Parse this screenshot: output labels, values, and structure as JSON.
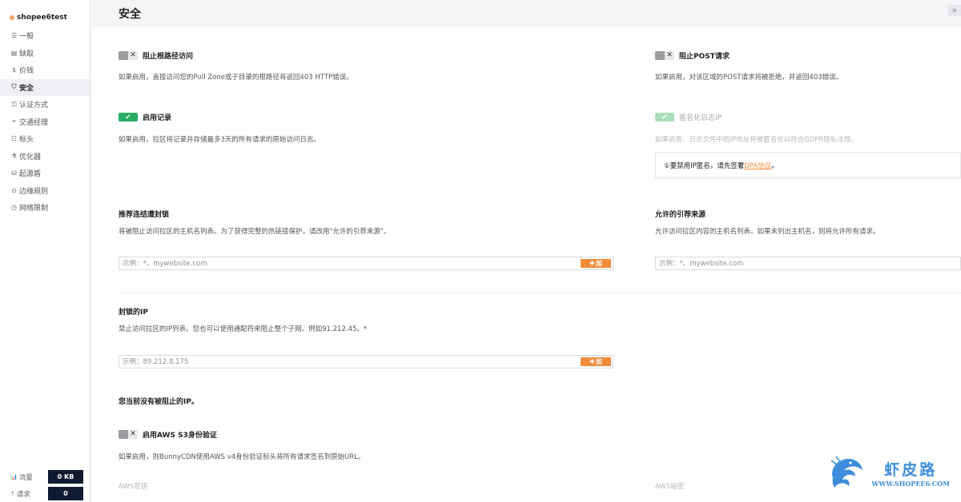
{
  "app": {
    "name": "shopee6test"
  },
  "sidebar": {
    "items": [
      {
        "icon": "☰",
        "label": "一般"
      },
      {
        "icon": "▤",
        "label": "缺取"
      },
      {
        "icon": "$",
        "label": "价钱"
      },
      {
        "icon": "⛉",
        "label": "安全"
      },
      {
        "icon": "⚿",
        "label": "认证方式"
      },
      {
        "icon": "⌖",
        "label": "交通经理"
      },
      {
        "icon": "☷",
        "label": "标头"
      },
      {
        "icon": "⚗",
        "label": "优化器"
      },
      {
        "icon": "⛁",
        "label": "起源盾"
      },
      {
        "icon": "⊙",
        "label": "边缘规则"
      },
      {
        "icon": "◷",
        "label": "网络限制"
      }
    ],
    "active_index": 3,
    "stats": [
      {
        "icon": "📊",
        "label": "流量",
        "value": "0 KB"
      },
      {
        "icon": "⇡",
        "label": "请求",
        "value": "0"
      }
    ]
  },
  "header": {
    "title": "安全",
    "menu_icon": "≡"
  },
  "settings": {
    "block_root": {
      "title": "阻止根路径访问",
      "desc": "如果启用，直接访问您的Pull Zone或子目录的根路径将返回403 HTTP错误。",
      "state": "off"
    },
    "block_post": {
      "title": "阻止POST请求",
      "desc": "如果启用，对该区域的POST请求将被拒绝，并返回403错误。",
      "state": "off"
    },
    "enable_logging": {
      "title": "启用记录",
      "desc": "如果启用，拉区将记录并存储最多3天的所有请求的原始访问日志。",
      "state": "on"
    },
    "anonymize_ip": {
      "title": "匿名化日志IP",
      "desc": "如果启用，日志文件中的IP地址将被匿名化以符合GDPR隐私法规。",
      "state": "on-disabled"
    },
    "dpa_notice": {
      "prefix": "①要禁用IP匿名，请先签署",
      "link": "DPA协议",
      "suffix": "。"
    },
    "aws_auth": {
      "title": "启用AWS S3身份验证",
      "desc": "如果启用，则BunnyCDN使用AWS v4身份验证标头将所有请求签名到原始URL。",
      "state": "off"
    }
  },
  "blocked_referrers": {
    "title": "推荐连结遭封锁",
    "desc": "将被阻止访问拉区的主机名列表。为了获得完整的热链接保护，请改用\"允许的引荐来源\"。",
    "placeholder": "示例：*。mywebsite.com",
    "add_label": "加"
  },
  "allowed_referrers": {
    "title": "允许的引荐来源",
    "desc": "允许访问拉区内容的主机名列表。如果未列出主机名，则将允许所有请求。",
    "placeholder": "示例：*。mywebsite.com"
  },
  "blocked_ips": {
    "title": "封锁的IP",
    "desc": "禁止访问拉区的IP列表。您也可以使用通配符来阻止整个子网。例如91.212.45。*",
    "placeholder": "示例：89.212.8.175",
    "add_label": "加",
    "empty_text": "您当前没有被阻止的IP。"
  },
  "aws_fields": {
    "key_label": "AWS密钥",
    "secret_label": "AWS秘密"
  },
  "watermark": {
    "cn": "虾皮路",
    "en": "WWW.SHOPEE6.COM"
  }
}
